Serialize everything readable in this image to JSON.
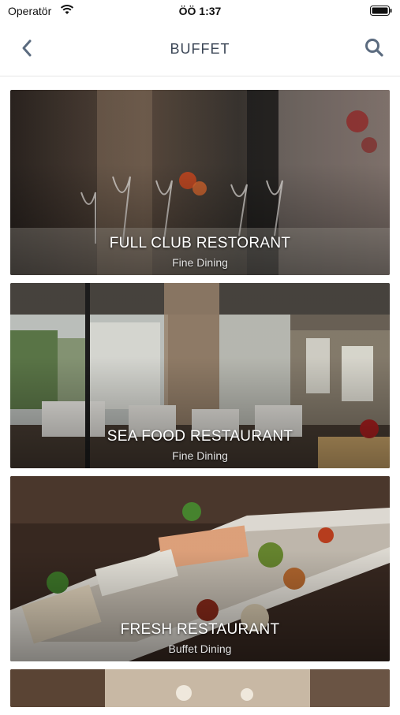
{
  "status_bar": {
    "carrier": "Operatör",
    "time": "ÖÖ 1:37"
  },
  "nav": {
    "title": "BUFFET",
    "back_icon": "chevron-left-icon",
    "search_icon": "search-icon"
  },
  "restaurants": [
    {
      "name": "FULL CLUB RESTORANT",
      "category": "Fine Dining"
    },
    {
      "name": "SEA FOOD RESTAURANT",
      "category": "Fine Dining"
    },
    {
      "name": "FRESH RESTAURANT",
      "category": "Buffet Dining"
    }
  ],
  "colors": {
    "title": "#3b4656",
    "accent_icon": "#5b6b7f"
  }
}
